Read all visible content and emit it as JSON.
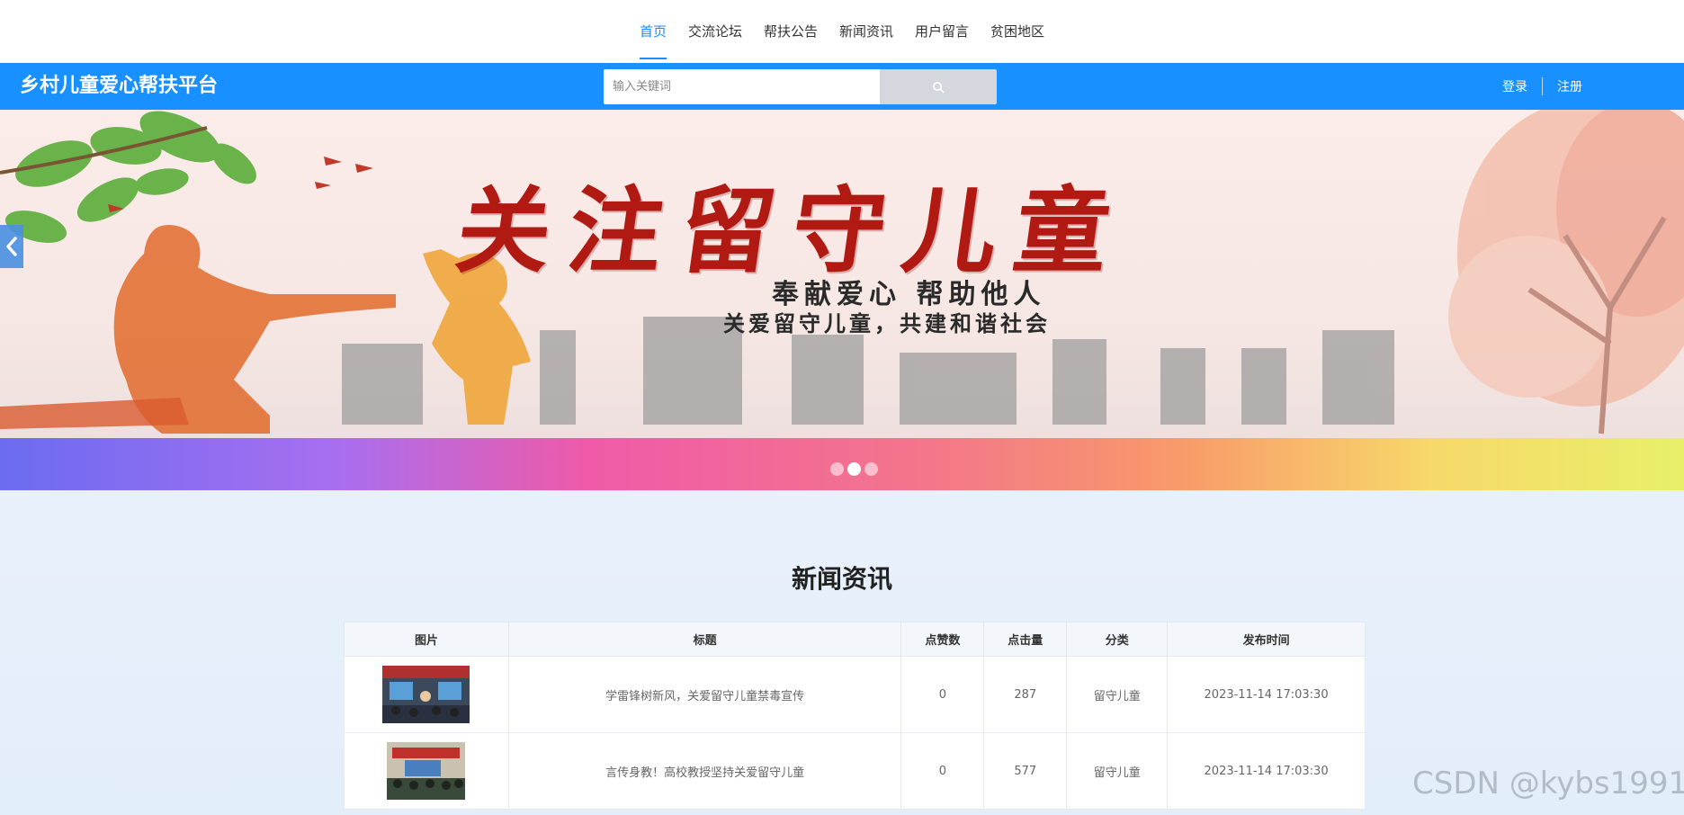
{
  "nav": {
    "items": [
      {
        "label": "首页",
        "active": true
      },
      {
        "label": "交流论坛",
        "active": false
      },
      {
        "label": "帮扶公告",
        "active": false
      },
      {
        "label": "新闻资讯",
        "active": false
      },
      {
        "label": "用户留言",
        "active": false
      },
      {
        "label": "贫困地区",
        "active": false
      }
    ]
  },
  "header": {
    "site_title": "乡村儿童爱心帮扶平台",
    "search_placeholder": "输入关键词",
    "search_icon": "search-icon",
    "login_label": "登录",
    "register_label": "注册",
    "brand_color": "#1890ff"
  },
  "banner": {
    "headline": "关注留守儿童",
    "subline1": "奉献爱心  帮助他人",
    "subline2": "关爱留守儿童，共建和谐社会",
    "prev_icon": "chevron-left-icon",
    "slide_count": 3,
    "active_slide": 2
  },
  "news": {
    "title": "新闻资讯",
    "columns": [
      "图片",
      "标题",
      "点赞数",
      "点击量",
      "分类",
      "发布时间"
    ],
    "rows": [
      {
        "title": "学雷锋树新风，关爱留守儿童禁毒宣传",
        "likes": "0",
        "clicks": "287",
        "category": "留守儿童",
        "time": "2023-11-14 17:03:30"
      },
      {
        "title": "言传身教！高校教授坚持关爱留守儿童",
        "likes": "0",
        "clicks": "577",
        "category": "留守儿童",
        "time": "2023-11-14 17:03:30"
      }
    ]
  },
  "watermark": "CSDN @kybs1991"
}
